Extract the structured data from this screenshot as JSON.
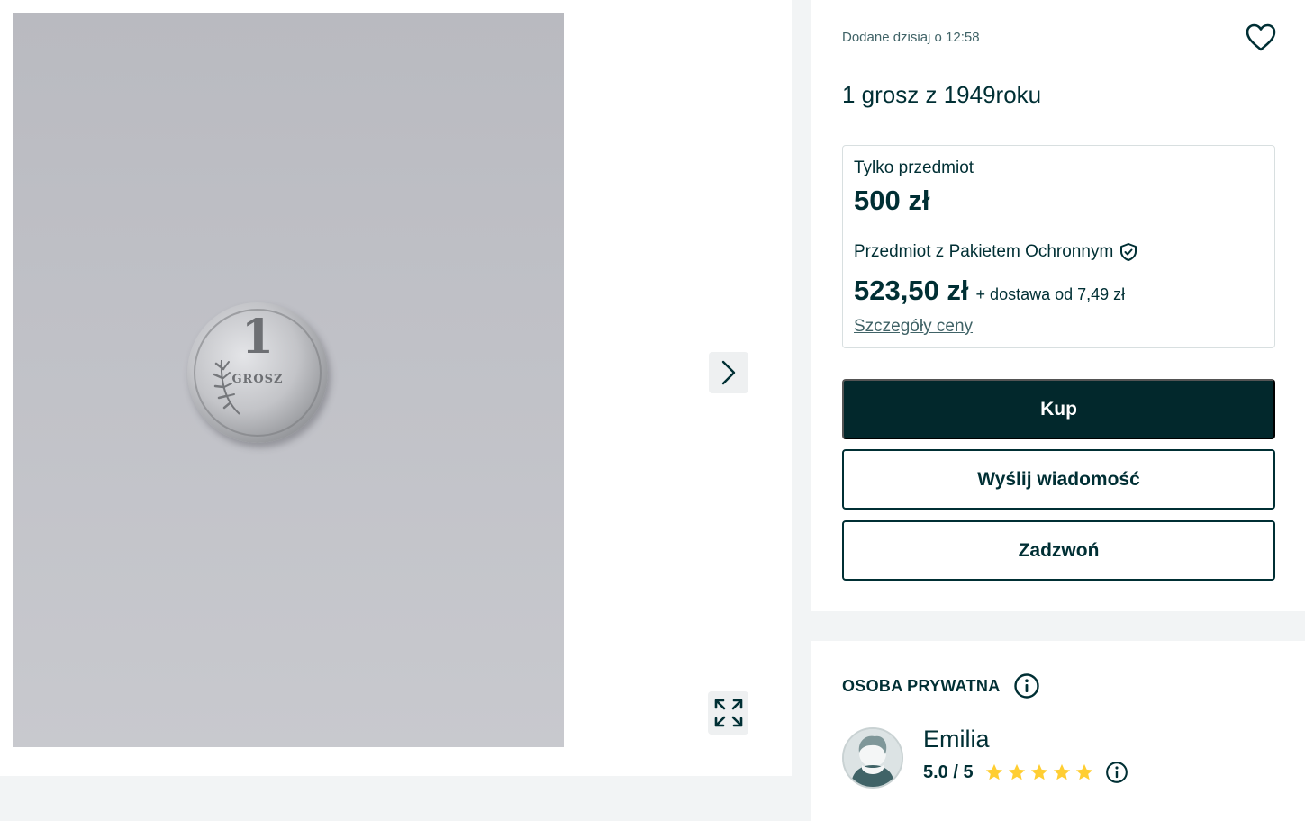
{
  "gallery": {
    "coin_numeral": "1",
    "coin_word": "GROSZ",
    "icons": {
      "next": "chevron-right-icon",
      "expand": "expand-arrows-icon"
    }
  },
  "offer": {
    "added": "Dodane dzisiaj o 12:58",
    "title": "1 grosz z 1949roku",
    "favorite_icon": "heart-outline-icon",
    "item_only_label": "Tylko przedmiot",
    "item_only_price": "500 zł",
    "protection_label": "Przedmiot z Pakietem Ochronnym",
    "protection_icon": "shield-check-icon",
    "protection_price": "523,50 zł",
    "delivery_text": "+ dostawa od 7,49 zł",
    "price_details_link": "Szczegóły ceny",
    "buttons": {
      "buy": "Kup",
      "message": "Wyślij wiadomość",
      "call": "Zadzwoń"
    }
  },
  "seller": {
    "type_label": "OSOBA PRYWATNA",
    "name": "Emilia",
    "rating_text": "5.0 / 5",
    "rating": 5,
    "rating_max": 5
  },
  "colors": {
    "primary": "#002f34",
    "buy_button": "#02282c",
    "star": "#ffce32",
    "page_bg": "#f2f4f5"
  }
}
